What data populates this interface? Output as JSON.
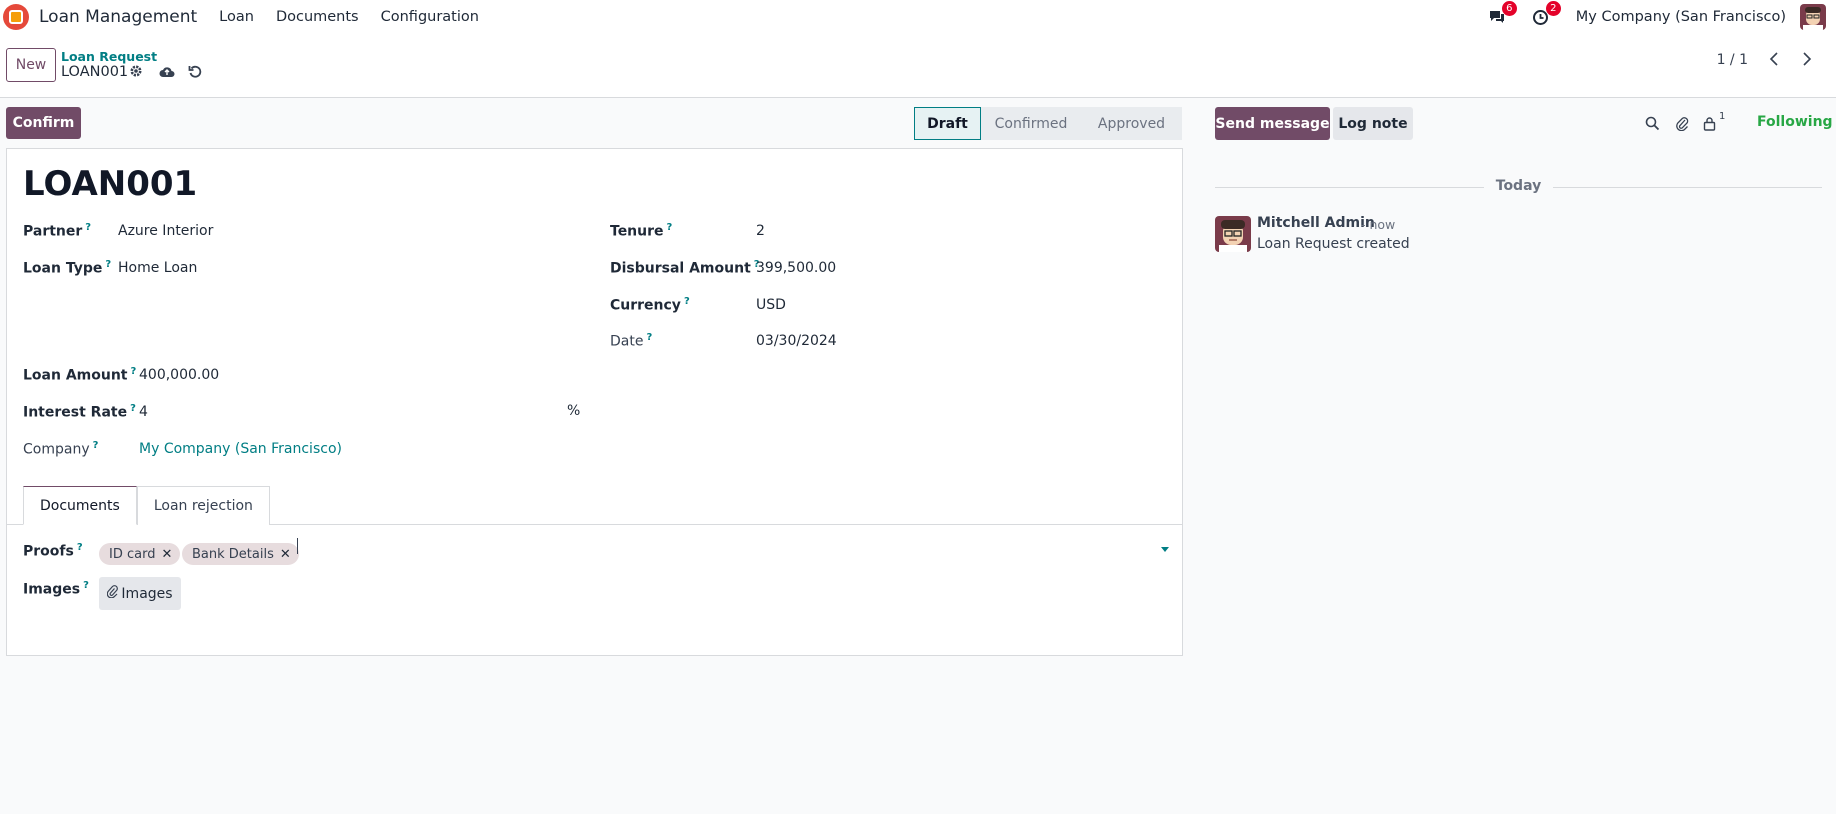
{
  "navbar": {
    "app_title": "Loan Management",
    "menu": [
      "Loan",
      "Documents",
      "Configuration"
    ],
    "messages_badge": "6",
    "activities_badge": "2",
    "company": "My Company (San Francisco)"
  },
  "control_panel": {
    "new_label": "New",
    "breadcrumb": "Loan Request",
    "record_name": "LOAN001",
    "pager": "1 / 1"
  },
  "actions": {
    "confirm_label": "Confirm"
  },
  "statusbar": {
    "stages": [
      "Draft",
      "Confirmed",
      "Approved"
    ],
    "active": "Draft"
  },
  "form": {
    "title": "LOAN001",
    "partner_label": "Partner",
    "partner_value": "Azure Interior",
    "loan_type_label": "Loan Type",
    "loan_type_value": "Home Loan",
    "tenure_label": "Tenure",
    "tenure_value": "2",
    "disbursal_label": "Disbursal Amount",
    "disbursal_value": "399,500.00",
    "currency_label": "Currency",
    "currency_value": "USD",
    "date_label": "Date",
    "date_value": "03/30/2024",
    "loan_amount_label": "Loan Amount",
    "loan_amount_value": "400,000.00",
    "interest_label": "Interest Rate",
    "interest_value": "4",
    "interest_unit": "%",
    "company_label": "Company",
    "company_value": "My Company (San Francisco)",
    "help_mark": "?"
  },
  "tabs": [
    "Documents",
    "Loan rejection"
  ],
  "documents": {
    "proofs_label": "Proofs",
    "proof_tags": [
      "ID card",
      "Bank Details"
    ],
    "images_label": "Images",
    "images_button": "Images"
  },
  "chatter": {
    "send_message": "Send message",
    "log_note": "Log note",
    "follower_count": "1",
    "following": "Following",
    "day": "Today",
    "message": {
      "author": "Mitchell Admin",
      "time": "- now",
      "body": "Loan Request created"
    }
  },
  "colors": {
    "brand": "#714b67",
    "link": "#017e84",
    "following": "#28a745",
    "badge": "#e4022a"
  },
  "icons": [
    "app-logo-icon",
    "chat-icon",
    "clock-icon",
    "gear-icon",
    "cloud-upload-icon",
    "undo-icon",
    "chevron-left-icon",
    "chevron-right-icon",
    "search-icon",
    "paperclip-icon",
    "lock-icon",
    "close-icon",
    "caret-down-icon"
  ]
}
